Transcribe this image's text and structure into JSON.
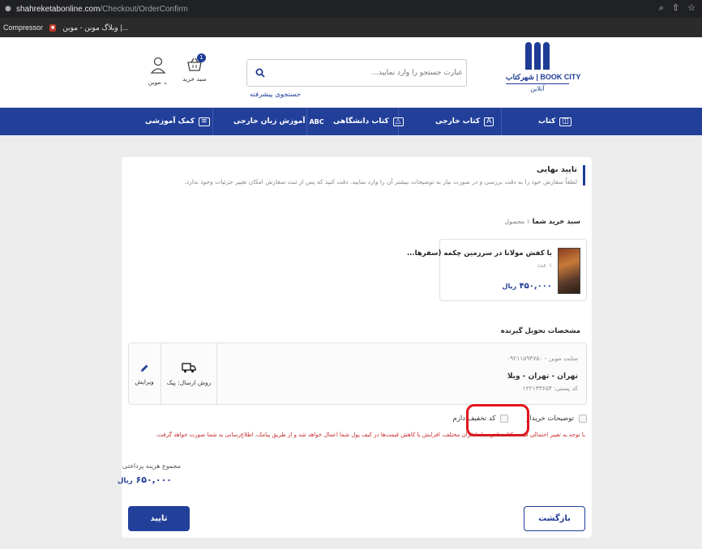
{
  "browser": {
    "url_domain": "shahreketabonline.com",
    "url_path": "/Checkout/OrderConfirm",
    "bookmarks": [
      {
        "label": "Compressor"
      },
      {
        "label": "وبلاگ موبن - موبن |..."
      }
    ]
  },
  "header": {
    "logo_title": "شهرکتاب | BOOK CITY",
    "logo_subtitle": "آنلاین",
    "search_placeholder": "عبارت جستجو را وارد نمایید...",
    "advanced_search": "جستجوی پیشرفته",
    "cart_label": "سبد خرید",
    "cart_count": "1",
    "user_label": "موبن"
  },
  "nav": {
    "items": [
      {
        "label": "کتاب",
        "icon": "book-icon"
      },
      {
        "label": "کتاب خارجی",
        "icon": "book-icon"
      },
      {
        "label": "کتاب دانشگاهی",
        "icon": "graduation-cap-icon"
      },
      {
        "label": "آموزش زبان خارجی",
        "icon": "abc-icon"
      },
      {
        "label": "کمک آموزشی",
        "icon": "notebook-icon"
      }
    ]
  },
  "confirm": {
    "title": "تایید نهایی",
    "description": "لطفاً سفارش خود را به دقت بررسی و در صورت نیاز به توضیحات بیشتر آن را وارد نمایید. دقت کنید که پس از ثبت سفارش امکان تغییر جزئیات وجود ندارد."
  },
  "cart": {
    "title": "سبد خرید شما",
    "count_text": "۱ محصول",
    "product": {
      "title": "با کفش مولانا در سرزمین چکمه (سفرها...",
      "qty": "۱ عدد",
      "price": "۴۵۰,۰۰۰",
      "currency": "ریال"
    }
  },
  "delivery": {
    "title": "مشخصات تحویل گیرنده",
    "receiver": "سایت موبن - ۰۹۲۱۱۵۹۴۷۵۰",
    "address": "تهران - تهران - ویلا",
    "postal": "کد پستی: ۱۲۲۱۳۳۶۵۴",
    "shipping_label": "روش ارسال: پیک",
    "edit_label": "ویرایش"
  },
  "options": {
    "buyer_notes": "توضیحات خریدار",
    "discount": "کد تخفیف دارم"
  },
  "warning": "با توجه به تغییر احتمالی قیمت کتاب‌ها توسط ناشران مختلف، افزایش یا کاهش قیمت‌ها در کیف پول شما اعمال خواهد شد و از طریق پیامک، اطلاع‌رسانی به شما صورت خواهد گرفت.",
  "total": {
    "label": "مجموع هزینه پرداختی",
    "value": "۶۵۰,۰۰۰",
    "currency": "ریال"
  },
  "buttons": {
    "back": "بازگشت",
    "confirm": "تایید"
  },
  "colors": {
    "brand": "#22409a",
    "warning": "#c62828",
    "highlight": "#e0141c"
  }
}
